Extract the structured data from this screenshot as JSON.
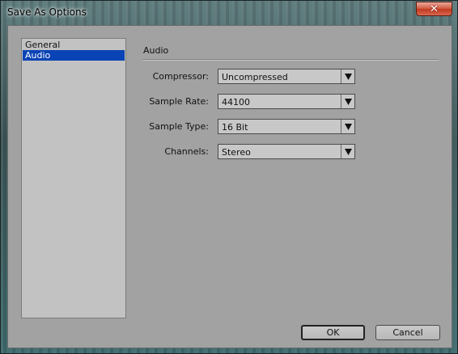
{
  "window": {
    "title": "Save As Options",
    "close_glyph": "✕"
  },
  "sidebar": {
    "items": [
      {
        "label": "General",
        "selected": false
      },
      {
        "label": "Audio",
        "selected": true
      }
    ]
  },
  "section": {
    "title": "Audio"
  },
  "fields": [
    {
      "label": "Compressor:",
      "value": "Uncompressed"
    },
    {
      "label": "Sample Rate:",
      "value": "44100"
    },
    {
      "label": "Sample Type:",
      "value": "16 Bit"
    },
    {
      "label": "Channels:",
      "value": "Stereo"
    }
  ],
  "buttons": {
    "ok": "OK",
    "cancel": "Cancel"
  },
  "colors": {
    "selection": "#0a43b5",
    "close_button": "#c23a1f",
    "panel": "#a2a2a2"
  }
}
